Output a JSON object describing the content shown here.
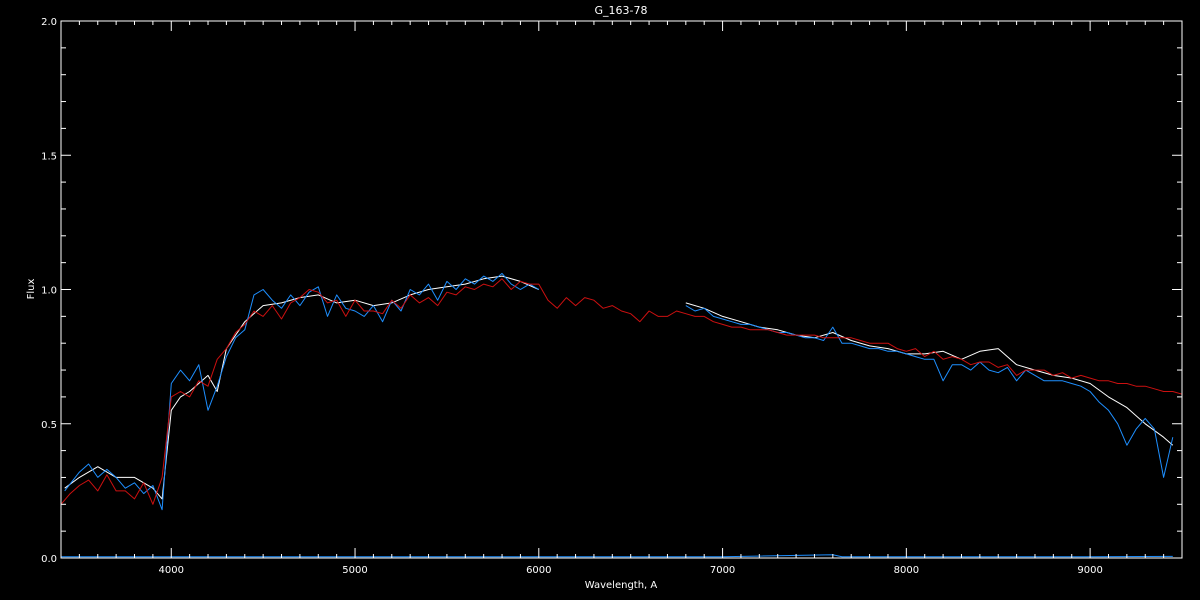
{
  "chart_data": {
    "type": "line",
    "title": "G_163-78",
    "xlabel": "Wavelength, A",
    "ylabel": "Flux",
    "xlim": [
      3400,
      9500
    ],
    "ylim": [
      0.0,
      2.0
    ],
    "x_ticks": [
      4000,
      5000,
      6000,
      7000,
      8000,
      9000
    ],
    "x_tick_labels": [
      "4000",
      "5000",
      "6000",
      "7000",
      "8000",
      "9000"
    ],
    "y_ticks": [
      0.0,
      0.5,
      1.0,
      1.5,
      2.0
    ],
    "y_tick_labels": [
      "0.0",
      "0.5",
      "1.0",
      "1.5",
      "2.0"
    ],
    "grid": false,
    "background": "#000000",
    "series": [
      {
        "color": "#ffffff",
        "segments": [
          {
            "x": [
              3420,
              3500,
              3600,
              3700,
              3800,
              3900,
              3950,
              4000,
              4050,
              4100,
              4200,
              4250,
              4300,
              4400,
              4500,
              4600,
              4700,
              4800,
              4900,
              5000,
              5100,
              5200,
              5300,
              5400,
              5500,
              5600,
              5700,
              5800,
              5900,
              6000
            ],
            "y": [
              0.26,
              0.3,
              0.34,
              0.3,
              0.3,
              0.26,
              0.22,
              0.55,
              0.6,
              0.62,
              0.68,
              0.62,
              0.78,
              0.88,
              0.94,
              0.95,
              0.97,
              0.98,
              0.95,
              0.96,
              0.94,
              0.95,
              0.98,
              1.0,
              1.01,
              1.02,
              1.04,
              1.05,
              1.03,
              1.0
            ]
          },
          {
            "x": [
              6800,
              6900,
              7000,
              7100,
              7200,
              7300,
              7400,
              7500,
              7600,
              7700,
              7800,
              7900,
              8000,
              8100,
              8200,
              8300,
              8400,
              8500,
              8600,
              8700,
              8800,
              8900,
              9000,
              9100,
              9200,
              9300,
              9400,
              9450
            ],
            "y": [
              0.95,
              0.93,
              0.9,
              0.88,
              0.86,
              0.85,
              0.83,
              0.82,
              0.84,
              0.81,
              0.79,
              0.78,
              0.76,
              0.76,
              0.77,
              0.74,
              0.77,
              0.78,
              0.72,
              0.7,
              0.68,
              0.67,
              0.65,
              0.6,
              0.56,
              0.5,
              0.45,
              0.42
            ]
          }
        ]
      },
      {
        "color": "#1e8fff",
        "segments": [
          {
            "x": [
              3420,
              3500,
              3550,
              3600,
              3650,
              3700,
              3750,
              3800,
              3850,
              3900,
              3950,
              4000,
              4050,
              4100,
              4150,
              4200,
              4250,
              4300,
              4350,
              4400,
              4450,
              4500,
              4550,
              4600,
              4650,
              4700,
              4750,
              4800,
              4850,
              4900,
              4950,
              5000,
              5050,
              5100,
              5150,
              5200,
              5250,
              5300,
              5350,
              5400,
              5450,
              5500,
              5550,
              5600,
              5650,
              5700,
              5750,
              5800,
              5850,
              5900,
              5950,
              6000
            ],
            "y": [
              0.25,
              0.32,
              0.35,
              0.3,
              0.33,
              0.3,
              0.26,
              0.28,
              0.24,
              0.27,
              0.18,
              0.65,
              0.7,
              0.66,
              0.72,
              0.55,
              0.64,
              0.75,
              0.82,
              0.85,
              0.98,
              1.0,
              0.96,
              0.93,
              0.98,
              0.94,
              0.99,
              1.01,
              0.9,
              0.98,
              0.93,
              0.92,
              0.9,
              0.94,
              0.88,
              0.96,
              0.92,
              1.0,
              0.98,
              1.02,
              0.96,
              1.03,
              1.0,
              1.04,
              1.02,
              1.05,
              1.03,
              1.06,
              1.02,
              1.0,
              1.02,
              1.0
            ]
          },
          {
            "x": [
              6800,
              6850,
              6900,
              6950,
              7000,
              7050,
              7100,
              7150,
              7200,
              7250,
              7300,
              7350,
              7400,
              7450,
              7500,
              7550,
              7600,
              7650,
              7700,
              7750,
              7800,
              7850,
              7900,
              7950,
              8000,
              8050,
              8100,
              8150,
              8200,
              8250,
              8300,
              8350,
              8400,
              8450,
              8500,
              8550,
              8600,
              8650,
              8700,
              8750,
              8800,
              8850,
              8900,
              8950,
              9000,
              9050,
              9100,
              9150,
              9200,
              9250,
              9300,
              9350,
              9400,
              9450
            ],
            "y": [
              0.94,
              0.92,
              0.93,
              0.9,
              0.89,
              0.88,
              0.87,
              0.87,
              0.86,
              0.85,
              0.84,
              0.84,
              0.83,
              0.82,
              0.82,
              0.81,
              0.86,
              0.8,
              0.8,
              0.79,
              0.78,
              0.78,
              0.77,
              0.77,
              0.76,
              0.75,
              0.74,
              0.74,
              0.66,
              0.72,
              0.72,
              0.7,
              0.73,
              0.7,
              0.69,
              0.71,
              0.66,
              0.7,
              0.68,
              0.66,
              0.66,
              0.66,
              0.65,
              0.64,
              0.62,
              0.58,
              0.55,
              0.5,
              0.42,
              0.48,
              0.52,
              0.48,
              0.3,
              0.45
            ]
          },
          {
            "x": [
              3400,
              4000,
              5000,
              6000,
              6800,
              7000,
              7600,
              7650,
              8000,
              9000,
              9450
            ],
            "y": [
              0.005,
              0.005,
              0.005,
              0.005,
              0.005,
              0.005,
              0.012,
              0.005,
              0.005,
              0.005,
              0.006
            ]
          }
        ]
      },
      {
        "color": "#cc1010",
        "segments": [
          {
            "x": [
              3400,
              3450,
              3500,
              3550,
              3600,
              3650,
              3700,
              3750,
              3800,
              3850,
              3900,
              3950,
              4000,
              4050,
              4100,
              4150,
              4200,
              4250,
              4300,
              4350,
              4400,
              4450,
              4500,
              4550,
              4600,
              4650,
              4700,
              4750,
              4800,
              4850,
              4900,
              4950,
              5000,
              5050,
              5100,
              5150,
              5200,
              5250,
              5300,
              5350,
              5400,
              5450,
              5500,
              5550,
              5600,
              5650,
              5700,
              5750,
              5800,
              5850,
              5900,
              5950,
              6000,
              6050,
              6100,
              6150,
              6200,
              6250,
              6300,
              6350,
              6400,
              6450,
              6500,
              6550,
              6600,
              6650,
              6700,
              6750,
              6800,
              6850,
              6900,
              6950,
              7000,
              7050,
              7100,
              7150,
              7200,
              7250,
              7300,
              7350,
              7400,
              7450,
              7500,
              7550,
              7600,
              7650,
              7700,
              7750,
              7800,
              7850,
              7900,
              7950,
              8000,
              8050,
              8100,
              8150,
              8200,
              8250,
              8300,
              8350,
              8400,
              8450,
              8500,
              8550,
              8600,
              8650,
              8700,
              8750,
              8800,
              8850,
              8900,
              8950,
              9000,
              9050,
              9100,
              9150,
              9200,
              9250,
              9300,
              9350,
              9400,
              9450,
              9500
            ],
            "y": [
              0.2,
              0.24,
              0.27,
              0.29,
              0.25,
              0.31,
              0.25,
              0.25,
              0.22,
              0.28,
              0.2,
              0.3,
              0.6,
              0.62,
              0.6,
              0.66,
              0.64,
              0.74,
              0.78,
              0.84,
              0.87,
              0.92,
              0.9,
              0.94,
              0.89,
              0.95,
              0.97,
              1.0,
              0.99,
              0.95,
              0.96,
              0.9,
              0.96,
              0.92,
              0.92,
              0.91,
              0.96,
              0.93,
              0.98,
              0.95,
              0.97,
              0.94,
              0.99,
              0.98,
              1.01,
              1.0,
              1.02,
              1.01,
              1.04,
              1.0,
              1.03,
              1.02,
              1.02,
              0.96,
              0.93,
              0.97,
              0.94,
              0.97,
              0.96,
              0.93,
              0.94,
              0.92,
              0.91,
              0.88,
              0.92,
              0.9,
              0.9,
              0.92,
              0.91,
              0.9,
              0.9,
              0.88,
              0.87,
              0.86,
              0.86,
              0.85,
              0.85,
              0.85,
              0.84,
              0.83,
              0.83,
              0.83,
              0.83,
              0.82,
              0.82,
              0.82,
              0.82,
              0.81,
              0.8,
              0.8,
              0.8,
              0.78,
              0.77,
              0.78,
              0.75,
              0.77,
              0.74,
              0.75,
              0.74,
              0.72,
              0.73,
              0.73,
              0.71,
              0.72,
              0.68,
              0.7,
              0.7,
              0.7,
              0.68,
              0.69,
              0.67,
              0.68,
              0.67,
              0.66,
              0.66,
              0.65,
              0.65,
              0.64,
              0.64,
              0.63,
              0.62,
              0.62,
              0.61
            ]
          }
        ]
      }
    ]
  }
}
